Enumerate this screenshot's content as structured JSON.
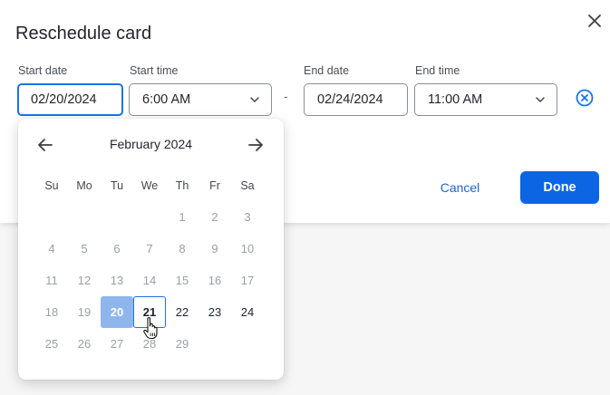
{
  "dialog": {
    "title": "Reschedule card",
    "close_icon": "close-icon"
  },
  "start_date": {
    "label": "Start date",
    "value": "02/20/2024"
  },
  "start_time": {
    "label": "Start time",
    "value": "6:00 AM"
  },
  "separator": "-",
  "end_date": {
    "label": "End date",
    "value": "02/24/2024"
  },
  "end_time": {
    "label": "End time",
    "value": "11:00 AM"
  },
  "actions": {
    "cancel_label": "Cancel",
    "done_label": "Done"
  },
  "calendar": {
    "month_label": "February 2024",
    "weekdays": [
      "Su",
      "Mo",
      "Tu",
      "We",
      "Th",
      "Fr",
      "Sa"
    ],
    "days": [
      "",
      "",
      "",
      "",
      "1",
      "2",
      "3",
      "4",
      "5",
      "6",
      "7",
      "8",
      "9",
      "10",
      "11",
      "12",
      "13",
      "14",
      "15",
      "16",
      "17",
      "18",
      "19",
      "20",
      "21",
      "22",
      "23",
      "24",
      "25",
      "26",
      "27",
      "28",
      "29",
      "",
      ""
    ],
    "selected_day": "20",
    "hovered_day": "21",
    "active_days": [
      "21",
      "22",
      "23",
      "24"
    ]
  },
  "colors": {
    "accent": "#1a73e8",
    "primary_button": "#0c66e4",
    "selected_day_bg": "#8fb6ec",
    "disabled_text": "#9aa0a6"
  }
}
